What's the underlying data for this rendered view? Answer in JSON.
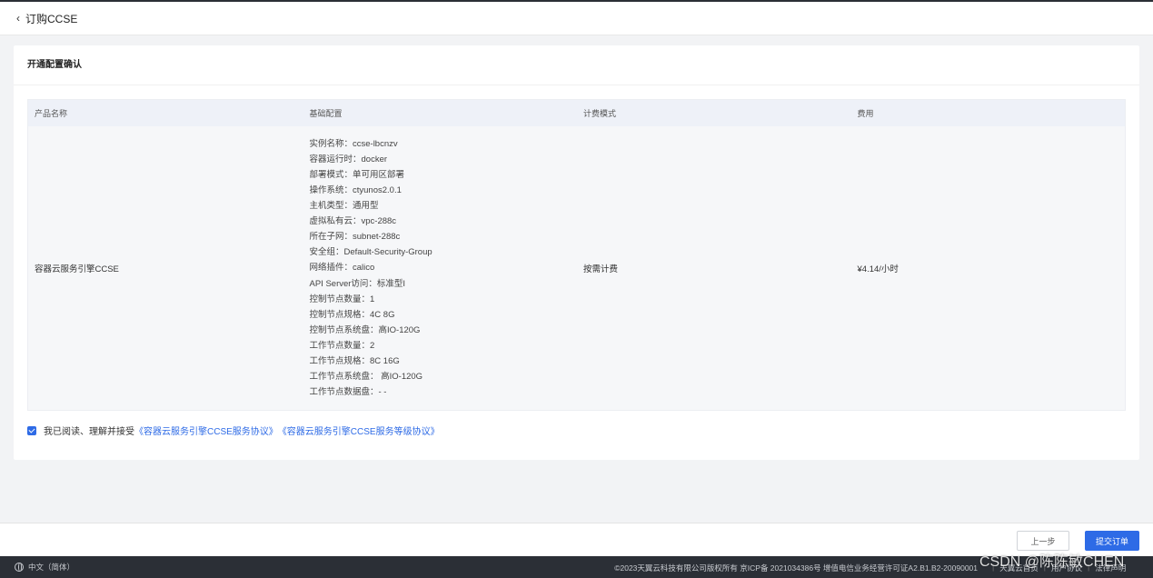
{
  "header": {
    "back_icon": "chevron-left-icon",
    "title": "订购CCSE"
  },
  "card": {
    "title": "开通配置确认",
    "table": {
      "headers": [
        "产品名称",
        "基础配置",
        "计费模式",
        "费用"
      ],
      "row": {
        "product_name": "容器云服务引擎CCSE",
        "config": [
          "实例名称：ccse-lbcnzv",
          "容器运行时：docker",
          "部署模式：单可用区部署",
          "操作系统：ctyunos2.0.1",
          "主机类型：通用型",
          "虚拟私有云：vpc-288c",
          "所在子网：subnet-288c",
          "安全组：Default-Security-Group",
          "网络插件：calico",
          "API Server访问：标准型I",
          "控制节点数量：1",
          "控制节点规格：4C 8G",
          "控制节点系统盘：高IO-120G",
          "工作节点数量：2",
          "工作节点规格：8C 16G",
          "工作节点系统盘： 高IO-120G",
          "工作节点数据盘：- -"
        ],
        "billing_mode": "按需计费",
        "fee": "¥4.14/小时"
      }
    },
    "agreement": {
      "checked": true,
      "text": "我已阅读、理解并接受",
      "link1": "《容器云服务引擎CCSE服务协议》",
      "link2": "《容器云服务引擎CCSE服务等级协议》"
    }
  },
  "actions": {
    "prev_label": "上一步",
    "submit_label": "提交订单"
  },
  "footer": {
    "language": "中文（简体）",
    "globe_icon": "globe-icon",
    "copyright": "©2023天翼云科技有限公司版权所有 京ICP备 2021034386号 增值电信业务经营许可证A2.B1.B2-20090001",
    "links": [
      "天翼云首页",
      "用户协议",
      "法律声明"
    ],
    "watermark": "CSDN @陈陈敏CHEN"
  },
  "colors": {
    "accent": "#2e6be6",
    "bottom_bar": "#2b2f36",
    "table_header": "#eef1f8"
  }
}
